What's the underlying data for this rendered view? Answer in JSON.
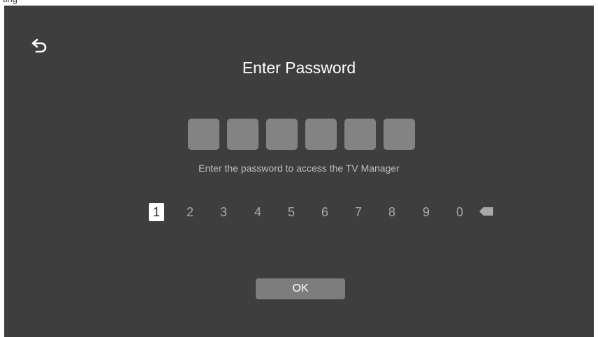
{
  "header_strip": {
    "partial_text": "ting"
  },
  "back_button": {
    "icon": "back-arrow-icon"
  },
  "title": "Enter Password",
  "pin": {
    "length": 6,
    "entered": 0
  },
  "hint": "Enter the password to access the TV Manager",
  "keypad": {
    "keys": [
      "1",
      "2",
      "3",
      "4",
      "5",
      "6",
      "7",
      "8",
      "9",
      "0"
    ],
    "selected": "1",
    "backspace_icon": "backspace-icon"
  },
  "ok_button": {
    "label": "OK"
  },
  "colors": {
    "background": "#3e3e3e",
    "pin_box": "#838383",
    "key_text": "#a9a9a9",
    "selected_key_bg": "#ffffff",
    "ok_button": "#7d7d7d"
  }
}
